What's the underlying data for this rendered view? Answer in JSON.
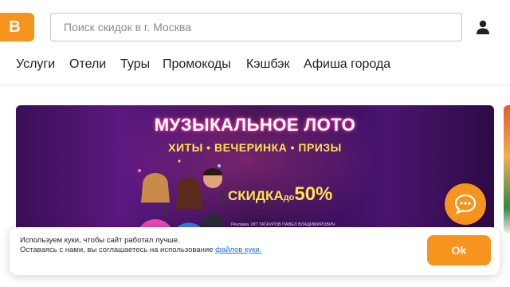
{
  "header": {
    "logo_letter": "B",
    "search_placeholder": "Поиск скидок в г. Москва",
    "user_icon": "user-icon"
  },
  "nav": {
    "items": [
      {
        "label": "Услуги"
      },
      {
        "label": "Отели"
      },
      {
        "label": "Туры"
      },
      {
        "label": "Промокоды"
      },
      {
        "label": "Кэшбэк"
      },
      {
        "label": "Афиша города"
      }
    ]
  },
  "banner": {
    "title": "МУЗЫКАЛЬНОЕ ЛОТО",
    "subtitle": "ХИТЫ • ВЕЧЕРИНКА • ПРИЗЫ",
    "discount_word": "СКИДКА",
    "discount_prefix": "до",
    "discount_value": "50%",
    "legal": "Реклама. ИП ТАТАУРОВ ПАВЕЛ ВЛАДИМИРОВИЧ"
  },
  "chat": {
    "icon": "chat-bubble-icon"
  },
  "cookie": {
    "title": "Используем куки, чтобы сайт работал лучше.",
    "text": "Оставаясь с нами, вы соглашаетесь на использование",
    "link_text": "файлов куки.",
    "ok_label": "Ok"
  },
  "colors": {
    "accent": "#f7941d",
    "link": "#1a73e8",
    "banner_bg": "#3a0f55",
    "banner_title_glow": "#ff3fa6",
    "banner_yellow": "#ffe34d"
  }
}
